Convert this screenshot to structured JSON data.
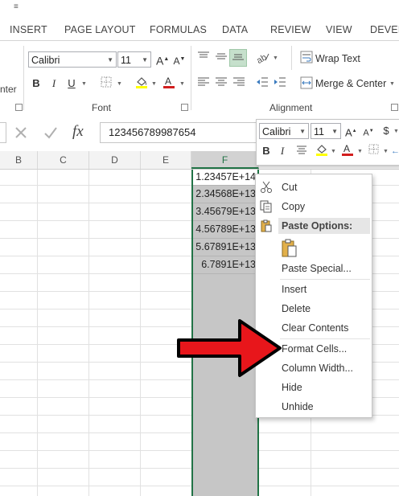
{
  "ribbon_tabs": [
    "INSERT",
    "PAGE LAYOUT",
    "FORMULAS",
    "DATA",
    "REVIEW",
    "VIEW",
    "DEVELO"
  ],
  "font_group": {
    "font_name": "Calibri",
    "font_size": "11",
    "label": "Font",
    "bold": "B",
    "italic": "I",
    "underline": "U"
  },
  "alignment_group": {
    "label": "Alignment",
    "wrap_text": "Wrap Text",
    "merge_center": "Merge & Center",
    "partial_left_label": "nter"
  },
  "formula_bar": {
    "fx": "fx",
    "value": "123456789987654"
  },
  "columns": [
    "B",
    "C",
    "D",
    "E",
    "F"
  ],
  "column_f_cells": [
    "1.23457E+14",
    "2.34568E+13",
    "3.45679E+13",
    "4.56789E+13",
    "5.67891E+13",
    "6.7891E+13"
  ],
  "mini_toolbar": {
    "font_name": "Calibri",
    "font_size": "11",
    "bold": "B",
    "italic": "I",
    "currency": "$"
  },
  "context_menu": {
    "cut": "Cut",
    "copy": "Copy",
    "paste_options": "Paste Options:",
    "paste_special": "Paste Special...",
    "insert": "Insert",
    "delete": "Delete",
    "clear_contents": "Clear Contents",
    "format_cells": "Format Cells...",
    "column_width": "Column Width...",
    "hide": "Hide",
    "unhide": "Unhide"
  },
  "colors": {
    "selection_gray": "#c6c6c6",
    "excel_green": "#217346",
    "arrow_red": "#e8161b",
    "font_color_red": "#d21e1e",
    "highlight_yellow": "#ffff00"
  }
}
